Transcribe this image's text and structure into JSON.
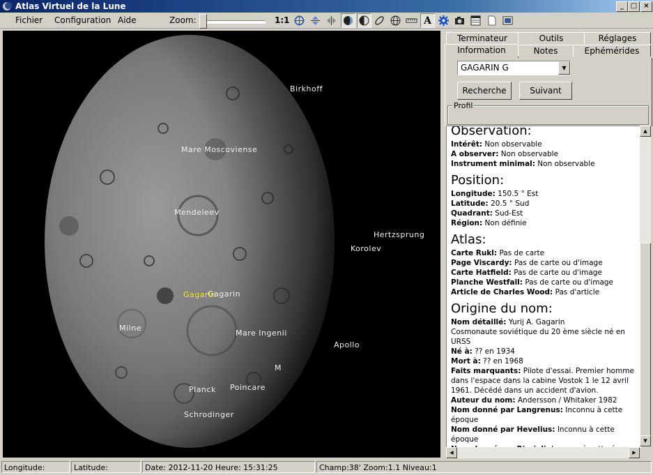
{
  "window": {
    "title": "Atlas Virtuel de la Lune"
  },
  "menu": {
    "items": [
      "Fichier",
      "Configuration",
      "Aide"
    ]
  },
  "toolbar": {
    "zoom_label": "Zoom:",
    "zoom_level": 0.0,
    "ratio_label": "1:1",
    "icons": [
      "target-icon",
      "flip-vertical-icon",
      "flip-horizontal-icon",
      "full-moon-icon",
      "phase-icon",
      "orbit-icon",
      "grid-icon",
      "ruler-icon",
      "text-icon",
      "settings-icon",
      "camera-icon",
      "calendar-icon",
      "document-icon",
      "screen-icon"
    ]
  },
  "map": {
    "labels": [
      {
        "text": "Birkhoff",
        "selected": false
      },
      {
        "text": "Mare Moscoviense",
        "selected": false
      },
      {
        "text": "Mendeleev",
        "selected": false
      },
      {
        "text": "Hertzsprung",
        "selected": false
      },
      {
        "text": "Korolev",
        "selected": false
      },
      {
        "text": "Gagarin",
        "selected": true
      },
      {
        "text": "Gagarin",
        "selected": false
      },
      {
        "text": "Milne",
        "selected": false
      },
      {
        "text": "Mare Ingenii",
        "selected": false
      },
      {
        "text": "Apollo",
        "selected": false
      },
      {
        "text": "M",
        "selected": false
      },
      {
        "text": "Planck",
        "selected": false
      },
      {
        "text": "Poincare",
        "selected": false
      },
      {
        "text": "Schrodinger",
        "selected": false
      }
    ]
  },
  "tabs": {
    "row1": [
      "Terminateur",
      "Outils",
      "Réglages"
    ],
    "row2": [
      "Information",
      "Notes",
      "Ephémérides"
    ],
    "active": "Information"
  },
  "search": {
    "selected": "GAGARIN G",
    "search_button": "Recherche",
    "next_button": "Suivant",
    "profile_label": "Profil"
  },
  "info": {
    "sections": [
      {
        "title": "Observation:",
        "lines": [
          {
            "k": "Intérêt:",
            "v": " Non observable"
          },
          {
            "k": "A observer:",
            "v": " Non observable"
          },
          {
            "k": "Instrument minimal:",
            "v": " Non observable"
          }
        ]
      },
      {
        "title": "Position:",
        "lines": [
          {
            "k": "Longitude:",
            "v": " 150.5 ° Est"
          },
          {
            "k": "Latitude:",
            "v": " 20.5 ° Sud"
          },
          {
            "k": "Quadrant:",
            "v": " Sud-Est"
          },
          {
            "k": "Région:",
            "v": " Non définie"
          }
        ]
      },
      {
        "title": "Atlas:",
        "lines": [
          {
            "k": "Carte Rukl:",
            "v": " Pas de carte"
          },
          {
            "k": "Page Viscardy:",
            "v": " Pas de carte ou d'image"
          },
          {
            "k": "Carte Hatfield:",
            "v": " Pas de carte ou d'image"
          },
          {
            "k": "Planche Westfall:",
            "v": " Pas de carte ou d'image"
          },
          {
            "k": "Article de Charles Wood:",
            "v": " Pas d'article"
          }
        ]
      },
      {
        "title": "Origine du nom:",
        "lines": [
          {
            "k": "Nom détaillé:",
            "v": " Yurij A. Gagarin"
          },
          {
            "k": "",
            "v": "Cosmonaute soviétique du 20 ème siècle né en URSS"
          },
          {
            "k": "Né à:",
            "v": " ?? en 1934"
          },
          {
            "k": "Mort à:",
            "v": " ?? en 1968"
          },
          {
            "k": "Faits marquants:",
            "v": " Pilote d'essai. Premier homme dans l'espace dans la cabine Vostok 1 le 12 avril 1961. Décédé dans un accident d'avion."
          },
          {
            "k": "Auteur du nom:",
            "v": " Andersson / Whitaker 1982"
          },
          {
            "k": "Nom donné par Langrenus:",
            "v": " Inconnu à cette époque"
          },
          {
            "k": "Nom donné par Hevelius:",
            "v": " Inconnu à cette époque"
          },
          {
            "k": "Nom donné par Riccioli:",
            "v": " Inconnu à cette époque"
          }
        ]
      }
    ]
  },
  "status": {
    "longitude": "Longitude:",
    "latitude": "Latitude:",
    "datetime": "Date: 2012-11-20  Heure: 15:31:25",
    "field": "Champ:38' Zoom:1.1  Niveau:1"
  }
}
